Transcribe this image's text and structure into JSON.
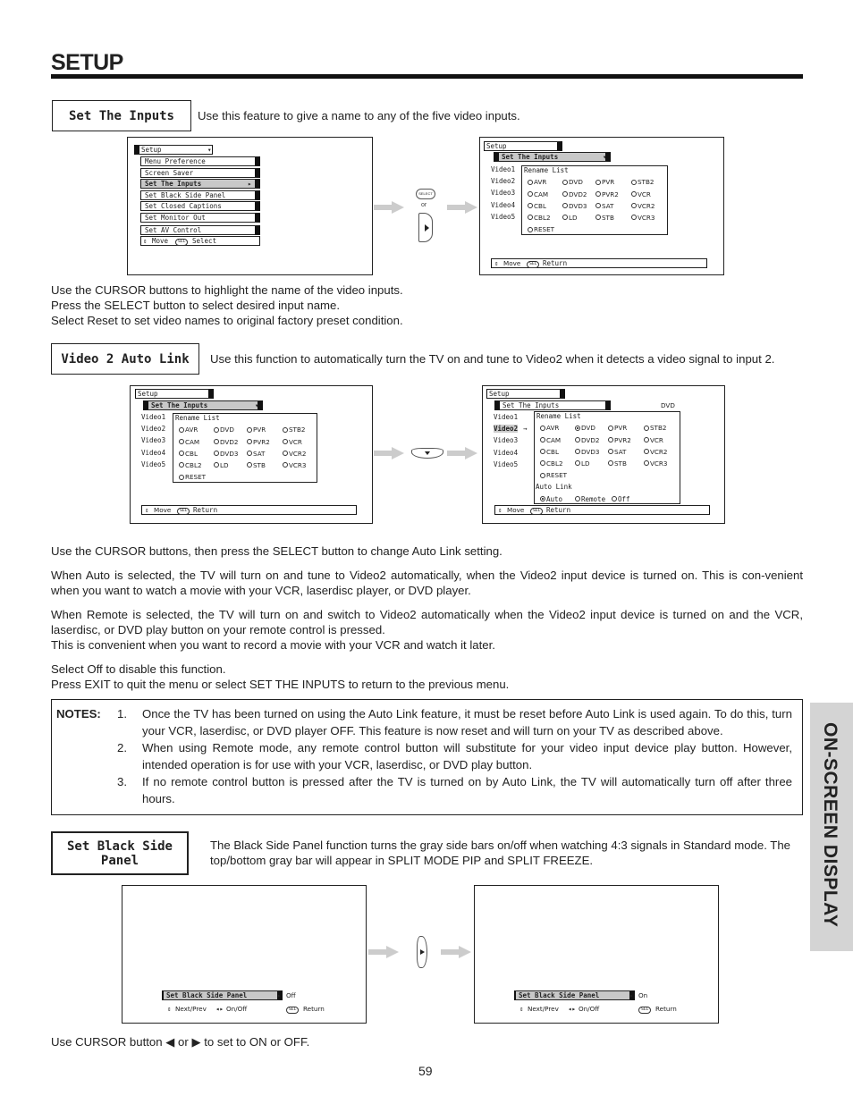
{
  "page": {
    "title": "SETUP",
    "page_number": "59",
    "side_tab": "ON-SCREEN DISPLAY"
  },
  "section1": {
    "label": "Set The Inputs",
    "intro": "Use this feature to give a name to any of the five video inputs.",
    "instructions": [
      "Use the CURSOR buttons to highlight the name of the video inputs.",
      "Press the SELECT button to select desired input name.",
      "Select Reset to set video names to original factory preset condition."
    ],
    "osd_left": {
      "header": "Setup",
      "items": [
        "Menu Preference",
        "Screen Saver",
        "Set The Inputs",
        "Set Black Side Panel",
        "Set Closed Captions",
        "Set Monitor Out",
        "Set AV Control"
      ],
      "highlighted_index": 2,
      "footer_move": "Move",
      "footer_sel": "SEL",
      "footer_action": "Select"
    },
    "connector": {
      "select_button": "SELECT",
      "or_text": "or"
    },
    "osd_right": {
      "header": "Setup",
      "submenu": "Set The Inputs",
      "videos": [
        "Video1",
        "Video2",
        "Video3",
        "Video4",
        "Video5"
      ],
      "rename_title": "Rename List",
      "options": [
        [
          "AVR",
          "DVD",
          "PVR",
          "STB2"
        ],
        [
          "CAM",
          "DVD2",
          "PVR2",
          "VCR"
        ],
        [
          "CBL",
          "DVD3",
          "SAT",
          "VCR2"
        ],
        [
          "CBL2",
          "LD",
          "STB",
          "VCR3"
        ]
      ],
      "reset": "RESET",
      "footer_move": "Move",
      "footer_sel": "SEL",
      "footer_action": "Return"
    }
  },
  "section2": {
    "label": "Video 2 Auto Link",
    "intro": "Use this function to automatically turn the TV on and tune to Video2 when it detects a video signal to input 2.",
    "osd_left": {
      "header": "Setup",
      "submenu": "Set The Inputs",
      "videos": [
        "Video1",
        "Video2",
        "Video3",
        "Video4",
        "Video5"
      ],
      "rename_title": "Rename List",
      "options": [
        [
          "AVR",
          "DVD",
          "PVR",
          "STB2"
        ],
        [
          "CAM",
          "DVD2",
          "PVR2",
          "VCR"
        ],
        [
          "CBL",
          "DVD3",
          "SAT",
          "VCR2"
        ],
        [
          "CBL2",
          "LD",
          "STB",
          "VCR3"
        ]
      ],
      "reset": "RESET",
      "footer_move": "Move",
      "footer_sel": "SEL",
      "footer_action": "Return"
    },
    "osd_right": {
      "header": "Setup",
      "submenu": "Set The Inputs",
      "current_name": "DVD",
      "videos": [
        "Video1",
        "Video2",
        "Video3",
        "Video4",
        "Video5"
      ],
      "selected_video": "Video2",
      "rename_title": "Rename List",
      "options": [
        [
          "AVR",
          "DVD",
          "PVR",
          "STB2"
        ],
        [
          "CAM",
          "DVD2",
          "PVR2",
          "VCR"
        ],
        [
          "CBL",
          "DVD3",
          "SAT",
          "VCR2"
        ],
        [
          "CBL2",
          "LD",
          "STB",
          "VCR3"
        ]
      ],
      "selected_option": "DVD",
      "reset": "RESET",
      "auto_link_title": "Auto Link",
      "auto_link_options": [
        "Auto",
        "Remote",
        "Off"
      ],
      "auto_link_selected": "Auto",
      "footer_move": "Move",
      "footer_sel": "SEL",
      "footer_action": "Return"
    },
    "paragraphs": [
      "Use the CURSOR buttons, then press the SELECT button to change Auto Link setting.",
      "When Auto is selected, the TV will turn on and tune to Video2 automatically, when the Video2 input device is turned on. This is con-venient when you want to watch a movie with your VCR, laserdisc player, or DVD player.",
      "When Remote is selected, the TV will turn on and switch to Video2 automatically when the Video2 input device is turned on and the VCR, laserdisc, or DVD play button on your remote control is pressed.",
      "This is convenient when you want to record a movie with your VCR and watch it later.",
      "Select Off to disable this function.",
      "Press EXIT to quit the menu or select SET THE INPUTS to return to the previous menu."
    ]
  },
  "notes": {
    "label": "NOTES:",
    "items": [
      {
        "num": "1.",
        "text": "Once the TV has been turned on using the Auto Link feature, it must be reset before Auto Link is used again. To do this, turn your VCR, laserdisc, or DVD player OFF. This feature is now reset and will turn on your TV as described above."
      },
      {
        "num": "2.",
        "text": "When using Remote mode, any remote control button will substitute for your video input device play button. However, intended operation is for use with your VCR, laserdisc, or DVD play button."
      },
      {
        "num": "3.",
        "text": "If no remote control button is pressed after the TV is turned on by Auto Link, the TV will automatically turn off after three hours."
      }
    ]
  },
  "section3": {
    "label": "Set Black Side Panel",
    "intro": "The Black Side Panel function turns the gray side bars on/off when watching 4:3 signals in Standard mode.  The top/bottom gray bar will appear in SPLIT MODE PIP and SPLIT FREEZE.",
    "osd_left": {
      "item": "Set Black Side Panel",
      "value": "Off",
      "hint_nav": "Next/Prev",
      "hint_toggle": "On/Off",
      "footer_sel": "SEL",
      "footer_action": "Return"
    },
    "osd_right": {
      "item": "Set Black Side Panel",
      "value": "On",
      "hint_nav": "Next/Prev",
      "hint_toggle": "On/Off",
      "footer_sel": "SEL",
      "footer_action": "Return"
    },
    "instruction": "Use CURSOR button ◀ or ▶ to set to ON or OFF."
  }
}
